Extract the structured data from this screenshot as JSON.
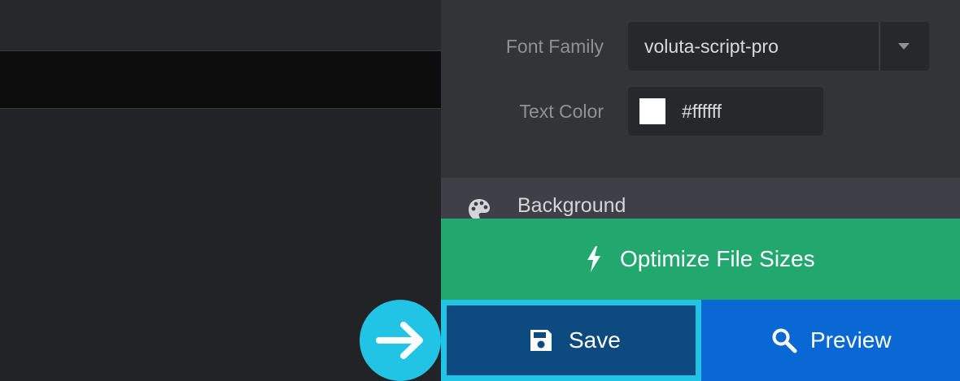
{
  "typography": {
    "font_family": {
      "label": "Font Family",
      "value": "voluta-script-pro"
    },
    "text_color": {
      "label": "Text Color",
      "value": "#ffffff",
      "swatch": "#ffffff"
    }
  },
  "background_section": {
    "title": "Background",
    "icon": "palette-icon"
  },
  "actions": {
    "optimize": {
      "label": "Optimize File Sizes",
      "icon": "lightning-icon",
      "color": "#22a86e"
    },
    "save": {
      "label": "Save",
      "icon": "floppy-disk-icon",
      "color": "#0c4a80",
      "highlight": "#22c4e6"
    },
    "preview": {
      "label": "Preview",
      "icon": "search-icon",
      "color": "#0a68d4"
    }
  },
  "pointer": {
    "icon": "arrow-right-icon",
    "color": "#22c4e6"
  }
}
